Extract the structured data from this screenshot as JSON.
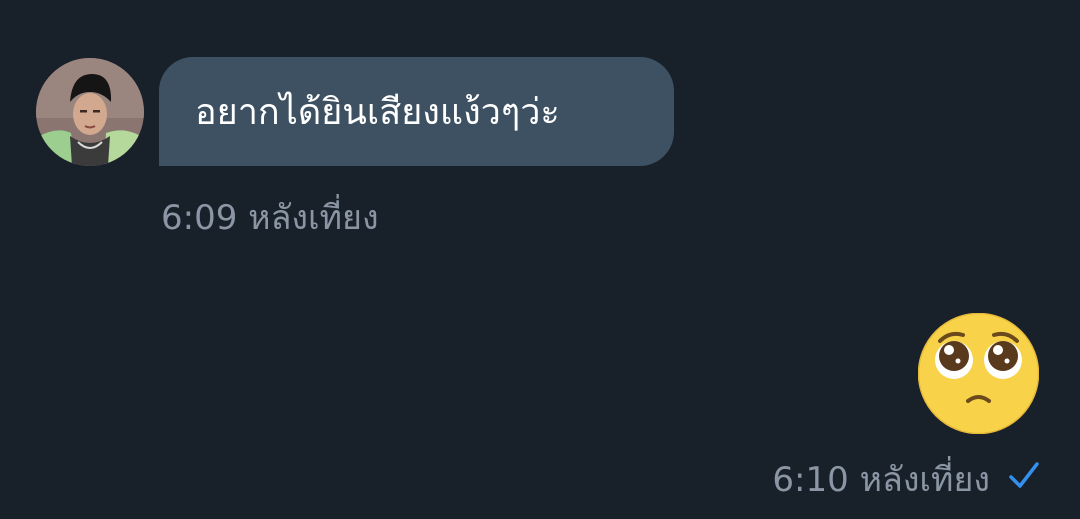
{
  "incoming_message": {
    "text": "อยากได้ยินเสียงแง้วๆว่ะ",
    "time": "6:09 หลังเที่ยง"
  },
  "outgoing_message": {
    "emoji": "pleading-face",
    "time": "6:10 หลังเที่ยง",
    "status": "read"
  },
  "colors": {
    "background": "#18202a",
    "incoming_bubble": "#3d5163",
    "timestamp_text": "#8a96a3",
    "read_check": "#3390ec",
    "emoji_face": "#f8d34a"
  }
}
